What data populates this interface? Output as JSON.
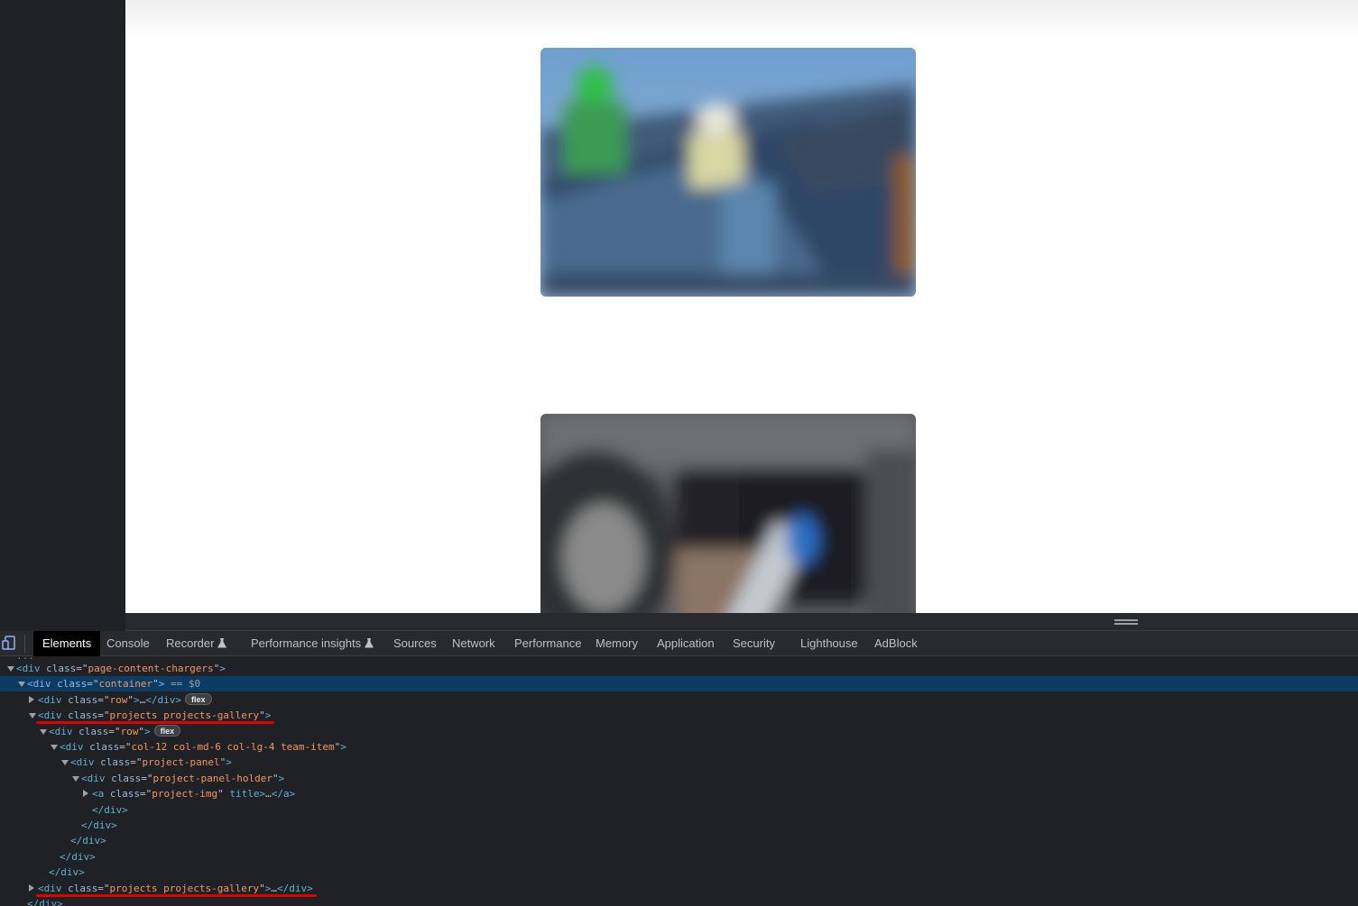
{
  "devtools": {
    "tabs": [
      {
        "label": "Elements",
        "active": true,
        "experimental": false
      },
      {
        "label": "Console",
        "active": false,
        "experimental": false
      },
      {
        "label": "Recorder",
        "active": false,
        "experimental": true
      },
      {
        "label": "Performance insights",
        "active": false,
        "experimental": true
      },
      {
        "label": "Sources",
        "active": false,
        "experimental": false
      },
      {
        "label": "Network",
        "active": false,
        "experimental": false
      },
      {
        "label": "Performance",
        "active": false,
        "experimental": false
      },
      {
        "label": "Memory",
        "active": false,
        "experimental": false
      },
      {
        "label": "Application",
        "active": false,
        "experimental": false
      },
      {
        "label": "Security",
        "active": false,
        "experimental": false
      },
      {
        "label": "Lighthouse",
        "active": false,
        "experimental": false
      },
      {
        "label": "AdBlock",
        "active": false,
        "experimental": false
      }
    ],
    "dom_lines": [
      {
        "expand": "down",
        "open": "<",
        "tag": "div",
        "attr": "class",
        "val": "page-content-chargers",
        "close": ">",
        "ellipsis": "",
        "end": "",
        "badge": "",
        "suffix": ""
      },
      {
        "expand": "down",
        "open": "<",
        "tag": "div",
        "attr": "class",
        "val": "container",
        "close": ">",
        "ellipsis": "",
        "end": "",
        "badge": "",
        "suffix": " == $0",
        "selected": true
      },
      {
        "expand": "right",
        "open": "<",
        "tag": "div",
        "attr": "class",
        "val": "row",
        "close": ">",
        "ellipsis": "…",
        "end": "</div>",
        "badge": "flex",
        "suffix": ""
      },
      {
        "expand": "down",
        "open": "<",
        "tag": "div",
        "attr": "class",
        "val": "projects projects-gallery",
        "close": ">",
        "ellipsis": "",
        "end": "",
        "badge": "",
        "suffix": "",
        "underlined": true
      },
      {
        "expand": "down",
        "open": "<",
        "tag": "div",
        "attr": "class",
        "val": "row",
        "close": ">",
        "ellipsis": "",
        "end": "",
        "badge": "flex",
        "suffix": ""
      },
      {
        "expand": "down",
        "open": "<",
        "tag": "div",
        "attr": "class",
        "val": "col-12 col-md-6 col-lg-4 team-item",
        "close": ">",
        "ellipsis": "",
        "end": "",
        "badge": "",
        "suffix": ""
      },
      {
        "expand": "down",
        "open": "<",
        "tag": "div",
        "attr": "class",
        "val": "project-panel",
        "close": ">",
        "ellipsis": "",
        "end": "",
        "badge": "",
        "suffix": ""
      },
      {
        "expand": "down",
        "open": "<",
        "tag": "div",
        "attr": "class",
        "val": "project-panel-holder",
        "close": ">",
        "ellipsis": "",
        "end": "",
        "badge": "",
        "suffix": ""
      },
      {
        "expand": "right",
        "open": "<",
        "tag": "a",
        "attr": "class",
        "val": "project-img",
        "close": " title>",
        "ellipsis": "…",
        "end": "</a>",
        "badge": "",
        "suffix": ""
      },
      {
        "expand": "",
        "open": "</",
        "tag": "div",
        "attr": "",
        "val": "",
        "close": ">",
        "ellipsis": "",
        "end": "",
        "badge": "",
        "suffix": ""
      },
      {
        "expand": "",
        "open": "</",
        "tag": "div",
        "attr": "",
        "val": "",
        "close": ">",
        "ellipsis": "",
        "end": "",
        "badge": "",
        "suffix": ""
      },
      {
        "expand": "",
        "open": "</",
        "tag": "div",
        "attr": "",
        "val": "",
        "close": ">",
        "ellipsis": "",
        "end": "",
        "badge": "",
        "suffix": ""
      },
      {
        "expand": "",
        "open": "</",
        "tag": "div",
        "attr": "",
        "val": "",
        "close": ">",
        "ellipsis": "",
        "end": "",
        "badge": "",
        "suffix": ""
      },
      {
        "expand": "",
        "open": "</",
        "tag": "div",
        "attr": "",
        "val": "",
        "close": ">",
        "ellipsis": "",
        "end": "",
        "badge": "",
        "suffix": ""
      },
      {
        "expand": "right",
        "open": "<",
        "tag": "div",
        "attr": "class",
        "val": "projects projects-gallery",
        "close": ">",
        "ellipsis": "…",
        "end": "</div>",
        "badge": "",
        "suffix": "",
        "underlined": true
      },
      {
        "expand": "",
        "open": "</",
        "tag": "div",
        "attr": "",
        "val": "",
        "close": ">",
        "ellipsis": "",
        "end": "",
        "badge": "",
        "suffix": ""
      }
    ]
  },
  "colors": {
    "page_bg": "#ffffff",
    "devtools_bg": "#202124",
    "selected_row": "#0b3c64",
    "annotation_underline": "#e00000",
    "attr_value": "#f29766",
    "tag_name": "#5db0d7"
  },
  "icons": {
    "device_toggle": "device-toolbar-icon",
    "experimental": "flask-icon",
    "resize": "drag-handle-icon"
  }
}
